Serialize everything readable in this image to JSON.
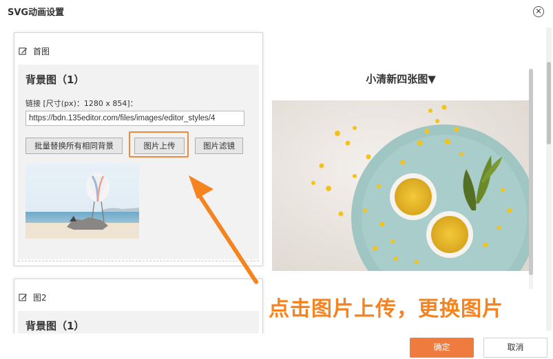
{
  "dialog": {
    "title": "SVG动画设置",
    "close_icon": "close-icon"
  },
  "cards": [
    {
      "header": "首图",
      "section_title": "背景图（1）",
      "link_label": "链接 [尺寸(px)：1280 x 854]：",
      "link_value": "https://bdn.135editor.com/files/images/editor_styles/4",
      "buttons": {
        "batch_replace": "批量替换所有相同背景",
        "upload": "图片上传",
        "filter": "图片滤镜"
      }
    },
    {
      "header": "图2",
      "section_title": "背景图（1）"
    }
  ],
  "preview": {
    "template_title": "小清新四张图▼"
  },
  "annotation": "点击图片上传，更换图片",
  "footer": {
    "ok_label": "确定",
    "cancel_label": "取消"
  },
  "colors": {
    "accent": "#f07b3f",
    "annotation": "#f5831f"
  }
}
